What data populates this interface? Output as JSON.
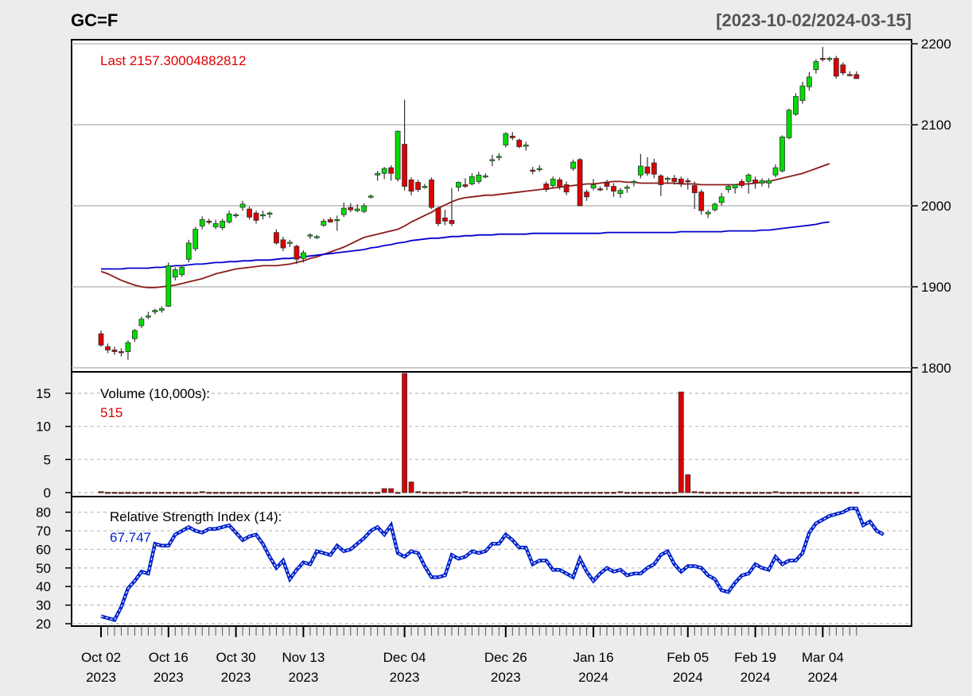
{
  "title": "GC=F",
  "date_range": "[2023-10-02/2024-03-15]",
  "colors": {
    "background": "#ececec",
    "panel": "#ffffff",
    "up": "#00dd00",
    "down": "#dd0000",
    "sma_short": "#8b1a1a",
    "sma_long": "#0000cc",
    "rsi": "#0022cc",
    "last_label": "#dd0000",
    "volume_value": "#dd0000"
  },
  "chart_data": [
    {
      "type": "candlestick",
      "panel": "price",
      "legend": {
        "label": "Last 2157.30004882812"
      },
      "ylim": [
        1795,
        2205
      ],
      "yticks": [
        1800,
        1900,
        2000,
        2100,
        2200
      ],
      "grid": true,
      "ohlc": [
        [
          1842,
          1846,
          1826,
          1828
        ],
        [
          1826,
          1830,
          1818,
          1822
        ],
        [
          1822,
          1826,
          1816,
          1820
        ],
        [
          1820,
          1824,
          1814,
          1819
        ],
        [
          1820,
          1834,
          1810,
          1831
        ],
        [
          1836,
          1848,
          1832,
          1846
        ],
        [
          1852,
          1863,
          1849,
          1860
        ],
        [
          1863,
          1869,
          1860,
          1864
        ],
        [
          1869,
          1873,
          1866,
          1871
        ],
        [
          1871,
          1876,
          1868,
          1873
        ],
        [
          1876,
          1930,
          1875,
          1926
        ],
        [
          1912,
          1924,
          1908,
          1921
        ],
        [
          1915,
          1927,
          1912,
          1924
        ],
        [
          1934,
          1958,
          1930,
          1954
        ],
        [
          1947,
          1974,
          1944,
          1971
        ],
        [
          1975,
          1987,
          1971,
          1983
        ],
        [
          1981,
          1984,
          1977,
          1980
        ],
        [
          1974,
          1983,
          1971,
          1978
        ],
        [
          1973,
          1984,
          1970,
          1981
        ],
        [
          1980,
          1994,
          1978,
          1990
        ],
        [
          1988,
          1991,
          1985,
          1989
        ],
        [
          1998,
          2006,
          1994,
          2002
        ],
        [
          1996,
          1999,
          1983,
          1986
        ],
        [
          1991,
          1994,
          1978,
          1982
        ],
        [
          1988,
          1994,
          1983,
          1989
        ],
        [
          1990,
          1993,
          1985,
          1991
        ],
        [
          1967,
          1971,
          1952,
          1954
        ],
        [
          1958,
          1962,
          1944,
          1948
        ],
        [
          1954,
          1958,
          1949,
          1955
        ],
        [
          1950,
          1952,
          1928,
          1934
        ],
        [
          1935,
          1945,
          1930,
          1942
        ],
        [
          1963,
          1966,
          1959,
          1964
        ],
        [
          1961,
          1964,
          1959,
          1962
        ],
        [
          1976,
          1984,
          1974,
          1981
        ],
        [
          1983,
          1986,
          1979,
          1980
        ],
        [
          1982,
          1988,
          1969,
          1983
        ],
        [
          1989,
          2004,
          1986,
          1997
        ],
        [
          1998,
          2003,
          1992,
          1995
        ],
        [
          1994,
          2002,
          1992,
          1996
        ],
        [
          1993,
          2003,
          1991,
          2000
        ],
        [
          2012,
          2014,
          2009,
          2012
        ],
        [
          2038,
          2043,
          2031,
          2040
        ],
        [
          2040,
          2048,
          2033,
          2046
        ],
        [
          2047,
          2050,
          2031,
          2040
        ],
        [
          2033,
          2093,
          2030,
          2092
        ],
        [
          2076,
          2131,
          2019,
          2024
        ],
        [
          2032,
          2035,
          2013,
          2018
        ],
        [
          2029,
          2032,
          2017,
          2020
        ],
        [
          2023,
          2027,
          2021,
          2024
        ],
        [
          2032,
          2035,
          1996,
          1998
        ],
        [
          1997,
          1999,
          1975,
          1978
        ],
        [
          1985,
          1995,
          1976,
          1981
        ],
        [
          1982,
          2022,
          1975,
          1978
        ],
        [
          2023,
          2030,
          2018,
          2029
        ],
        [
          2026,
          2034,
          2022,
          2024
        ],
        [
          2027,
          2040,
          2025,
          2036
        ],
        [
          2030,
          2042,
          2027,
          2038
        ],
        [
          2037,
          2040,
          2034,
          2037
        ],
        [
          2056,
          2063,
          2049,
          2057
        ],
        [
          2060,
          2065,
          2056,
          2061
        ],
        [
          2075,
          2091,
          2072,
          2089
        ],
        [
          2086,
          2091,
          2081,
          2084
        ],
        [
          2081,
          2083,
          2071,
          2073
        ],
        [
          2075,
          2079,
          2068,
          2075
        ],
        [
          2044,
          2048,
          2039,
          2043
        ],
        [
          2045,
          2050,
          2042,
          2046
        ],
        [
          2027,
          2030,
          2017,
          2020
        ],
        [
          2025,
          2036,
          2022,
          2033
        ],
        [
          2032,
          2035,
          2020,
          2024
        ],
        [
          2026,
          2030,
          2013,
          2017
        ],
        [
          2046,
          2057,
          2043,
          2054
        ],
        [
          2057,
          2059,
          2003,
          2000
        ],
        [
          2017,
          2020,
          2006,
          2011
        ],
        [
          2022,
          2033,
          2019,
          2026
        ],
        [
          2021,
          2024,
          2018,
          2020
        ],
        [
          2028,
          2032,
          2019,
          2024
        ],
        [
          2024,
          2028,
          2011,
          2018
        ],
        [
          2015,
          2022,
          2010,
          2019
        ],
        [
          2023,
          2026,
          2016,
          2023
        ],
        [
          2029,
          2032,
          2024,
          2030
        ],
        [
          2038,
          2064,
          2034,
          2049
        ],
        [
          2048,
          2060,
          2037,
          2040
        ],
        [
          2053,
          2058,
          2034,
          2039
        ],
        [
          2037,
          2039,
          2012,
          2026
        ],
        [
          2033,
          2036,
          2027,
          2034
        ],
        [
          2034,
          2038,
          2026,
          2030
        ],
        [
          2033,
          2036,
          2023,
          2028
        ],
        [
          2031,
          2034,
          2020,
          2030
        ],
        [
          2025,
          2030,
          1996,
          2016
        ],
        [
          2017,
          2020,
          1989,
          1994
        ],
        [
          1990,
          1995,
          1985,
          1992
        ],
        [
          1995,
          2004,
          1993,
          2002
        ],
        [
          2004,
          2016,
          2000,
          2011
        ],
        [
          2020,
          2026,
          2016,
          2024
        ],
        [
          2022,
          2027,
          2015,
          2026
        ],
        [
          2030,
          2033,
          2022,
          2025
        ],
        [
          2030,
          2040,
          2015,
          2038
        ],
        [
          2032,
          2036,
          2021,
          2028
        ],
        [
          2028,
          2034,
          2024,
          2031
        ],
        [
          2028,
          2034,
          2022,
          2031
        ],
        [
          2038,
          2051,
          2035,
          2047
        ],
        [
          2043,
          2087,
          2041,
          2085
        ],
        [
          2084,
          2120,
          2082,
          2118
        ],
        [
          2113,
          2139,
          2111,
          2135
        ],
        [
          2130,
          2153,
          2126,
          2148
        ],
        [
          2147,
          2165,
          2142,
          2159
        ],
        [
          2168,
          2181,
          2163,
          2178
        ],
        [
          2182,
          2196,
          2178,
          2181
        ],
        [
          2182,
          2184,
          2178,
          2182
        ],
        [
          2182,
          2185,
          2157,
          2160
        ],
        [
          2174,
          2177,
          2161,
          2164
        ],
        [
          2162,
          2166,
          2160,
          2161
        ],
        [
          2162,
          2166,
          2157,
          2157
        ]
      ],
      "series": [
        {
          "values": [
            1919,
            1916,
            1912,
            1908,
            1905,
            1902,
            1900,
            1899,
            1899,
            1900,
            1901,
            1902,
            1904,
            1906,
            1908,
            1910,
            1913,
            1916,
            1918,
            1920,
            1922,
            1923,
            1924,
            1925,
            1926,
            1926,
            1926,
            1927,
            1928,
            1930,
            1932,
            1935,
            1937,
            1940,
            1943,
            1946,
            1949,
            1953,
            1957,
            1961,
            1963,
            1965,
            1967,
            1969,
            1971,
            1975,
            1980,
            1984,
            1988,
            1992,
            1997,
            2001,
            2005,
            2008,
            2010,
            2011,
            2012,
            2013,
            2013,
            2014,
            2015,
            2016,
            2017,
            2018,
            2019,
            2020,
            2021,
            2022,
            2023,
            2024,
            2025,
            2026,
            2027,
            2027,
            2028,
            2029,
            2030,
            2030,
            2029,
            2029,
            2028,
            2028,
            2028,
            2028,
            2028,
            2028,
            2027,
            2027,
            2027,
            2026,
            2026,
            2026,
            2026,
            2026,
            2026,
            2027,
            2027,
            2028,
            2029,
            2030,
            2032,
            2034,
            2036,
            2038,
            2040,
            2043,
            2046,
            2049,
            2052
          ]
        },
        {
          "values": [
            1922,
            1922,
            1922,
            1922,
            1923,
            1923,
            1923,
            1923,
            1924,
            1924,
            1925,
            1926,
            1926,
            1927,
            1928,
            1928,
            1929,
            1930,
            1930,
            1931,
            1931,
            1932,
            1932,
            1933,
            1933,
            1933,
            1934,
            1935,
            1935,
            1936,
            1937,
            1938,
            1939,
            1940,
            1941,
            1942,
            1943,
            1944,
            1945,
            1946,
            1948,
            1949,
            1951,
            1952,
            1954,
            1955,
            1957,
            1958,
            1959,
            1960,
            1960,
            1961,
            1962,
            1962,
            1963,
            1963,
            1964,
            1964,
            1964,
            1965,
            1965,
            1965,
            1965,
            1965,
            1966,
            1966,
            1966,
            1966,
            1966,
            1966,
            1966,
            1966,
            1966,
            1966,
            1966,
            1967,
            1967,
            1967,
            1967,
            1967,
            1967,
            1967,
            1967,
            1967,
            1967,
            1967,
            1968,
            1968,
            1968,
            1968,
            1968,
            1968,
            1968,
            1969,
            1969,
            1969,
            1969,
            1969,
            1970,
            1970,
            1971,
            1972,
            1973,
            1974,
            1975,
            1976,
            1977,
            1979,
            1980
          ]
        }
      ]
    },
    {
      "type": "bar",
      "panel": "volume",
      "legend": {
        "label": "Volume (10,000s):",
        "value": "515"
      },
      "ylim": [
        0,
        18
      ],
      "yticks": [
        0,
        5,
        10,
        15
      ],
      "grid": true,
      "values": [
        0.15,
        0.05,
        0.05,
        0.04,
        0.05,
        0.04,
        0.05,
        0.05,
        0.05,
        0.05,
        0.05,
        0.05,
        0.05,
        0.05,
        0.05,
        0.15,
        0.05,
        0.05,
        0.05,
        0.05,
        0.05,
        0.05,
        0.05,
        0.05,
        0.05,
        0.05,
        0.05,
        0.05,
        0.05,
        0.05,
        0.05,
        0.05,
        0.05,
        0.05,
        0.05,
        0.05,
        0.05,
        0.05,
        0.05,
        0.05,
        0.05,
        0.05,
        0.6,
        0.6,
        0.05,
        18,
        1.6,
        0.15,
        0.06,
        0.05,
        0.05,
        0.05,
        0.05,
        0.05,
        0.15,
        0.05,
        0.05,
        0.05,
        0.05,
        0.05,
        0.05,
        0.05,
        0.05,
        0.05,
        0.05,
        0.05,
        0.05,
        0.05,
        0.05,
        0.05,
        0.05,
        0.05,
        0.05,
        0.05,
        0.05,
        0.05,
        0.05,
        0.15,
        0.05,
        0.05,
        0.05,
        0.05,
        0.05,
        0.05,
        0.05,
        0.05,
        15.2,
        2.7,
        0.15,
        0.1,
        0.05,
        0.05,
        0.05,
        0.05,
        0.05,
        0.05,
        0.05,
        0.05,
        0.05,
        0.05,
        0.15,
        0.05,
        0.05,
        0.05,
        0.05,
        0.05,
        0.05,
        0.05,
        0.05,
        0.05,
        0.05,
        0.05,
        0.05,
        0.05,
        0.05,
        0.05,
        0.05,
        0.05,
        0.05,
        0.05,
        0.05,
        0.05,
        0.05,
        0.05,
        0.05,
        0.05,
        0.05,
        0.05,
        0.05,
        0.05,
        0.05,
        0.05
      ]
    },
    {
      "type": "line",
      "panel": "rsi",
      "legend": {
        "label": "Relative Strength Index (14):",
        "value": "67.747"
      },
      "ylim": [
        20,
        85
      ],
      "yticks": [
        20,
        30,
        40,
        50,
        60,
        70,
        80
      ],
      "grid": true,
      "values": [
        24,
        23,
        22,
        29,
        39,
        43,
        48,
        47,
        63,
        62,
        62,
        68,
        70,
        72,
        70,
        69,
        71,
        71,
        72,
        73,
        69,
        65,
        67,
        68,
        63,
        56,
        50,
        54,
        44,
        49,
        53,
        52,
        59,
        58,
        57,
        62,
        59,
        60,
        63,
        66,
        70,
        72,
        68,
        73,
        58,
        56,
        59,
        58,
        51,
        45,
        45,
        46,
        57,
        55,
        56,
        59,
        58,
        59,
        63,
        63,
        68,
        65,
        61,
        61,
        52,
        54,
        54,
        49,
        49,
        47,
        45,
        55,
        48,
        43,
        47,
        50,
        48,
        49,
        46,
        47,
        47,
        50,
        52,
        57,
        59,
        52,
        48,
        51,
        51,
        50,
        46,
        44,
        38,
        37,
        42,
        46,
        47,
        52,
        50,
        49,
        56,
        52,
        54,
        54,
        58,
        69,
        74,
        76,
        78,
        79,
        80,
        82,
        82,
        73,
        75,
        70,
        68
      ]
    }
  ],
  "x_axis": {
    "tick_labels": [
      {
        "month": "Oct 02",
        "year": "2023"
      },
      {
        "month": "Oct 16",
        "year": "2023"
      },
      {
        "month": "Oct 30",
        "year": "2023"
      },
      {
        "month": "Nov 13",
        "year": "2023"
      },
      {
        "month": "Dec 04",
        "year": "2023"
      },
      {
        "month": "Dec 26",
        "year": "2023"
      },
      {
        "month": "Jan 16",
        "year": "2024"
      },
      {
        "month": "Feb 05",
        "year": "2024"
      },
      {
        "month": "Feb 19",
        "year": "2024"
      },
      {
        "month": "Mar 04",
        "year": "2024"
      }
    ]
  }
}
